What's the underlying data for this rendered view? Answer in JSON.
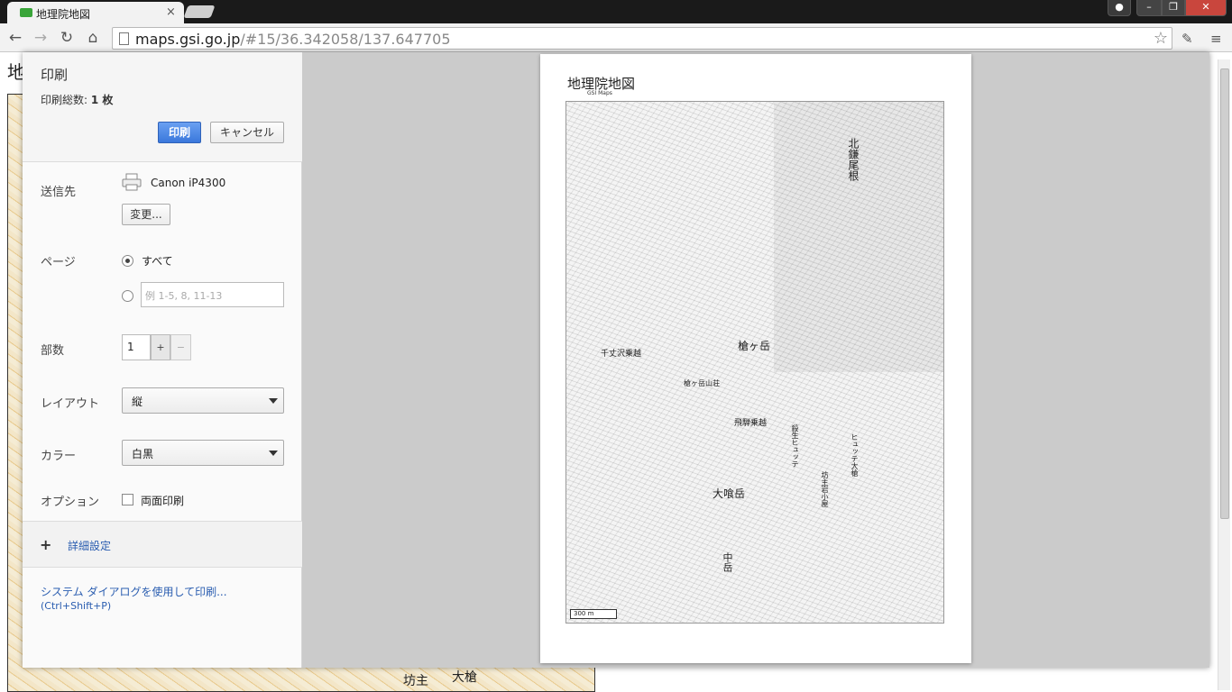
{
  "browser": {
    "tab_title": "地理院地図",
    "tab_close": "×",
    "url_host": "maps.gsi.go.jp",
    "url_path": "/#15/36.342058/137.647705"
  },
  "background_page": {
    "title_fragment": "地",
    "map_text_1": "坊主",
    "map_text_2": "大槍"
  },
  "print_panel": {
    "title": "印刷",
    "total_label": "印刷総数: ",
    "total_value": "1 枚",
    "print_button": "印刷",
    "cancel_button": "キャンセル",
    "destination_label": "送信先",
    "printer_name": "Canon iP4300",
    "change_button": "変更...",
    "pages_label": "ページ",
    "pages_all": "すべて",
    "pages_placeholder": "例 1-5, 8, 11-13",
    "copies_label": "部数",
    "copies_value": "1",
    "copies_plus": "+",
    "copies_minus": "−",
    "layout_label": "レイアウト",
    "layout_value": "縦",
    "color_label": "カラー",
    "color_value": "白黒",
    "options_label": "オプション",
    "duplex_label": "両面印刷",
    "advanced_label": "詳細設定",
    "system_dialog_link": "システム ダイアログを使用して印刷...",
    "system_dialog_shortcut": "(Ctrl+Shift+P)"
  },
  "preview": {
    "title": "地理院地図",
    "subtitle": "GSI Maps",
    "scale": "300 m",
    "labels": {
      "yarigatake": "槍ヶ岳",
      "yarigatake_sanso": "槍ヶ岳山荘",
      "hida_norikoshi": "飛騨乗越",
      "ookibata": "大喰岳",
      "nakadake": "中岳",
      "kitakama": "北鎌尾根",
      "senjozawa": "千丈沢乗越",
      "hyutte": "ヒュッテ大槍",
      "bozu": "坊主岩小屋",
      "sesshou": "殺生ヒュッテ"
    }
  },
  "icons": [
    "favicon-icon",
    "back-icon",
    "forward-icon",
    "reload-icon",
    "home-icon",
    "page-icon",
    "star-icon",
    "evernote-icon",
    "menu-icon",
    "printer-icon",
    "plus-icon"
  ]
}
